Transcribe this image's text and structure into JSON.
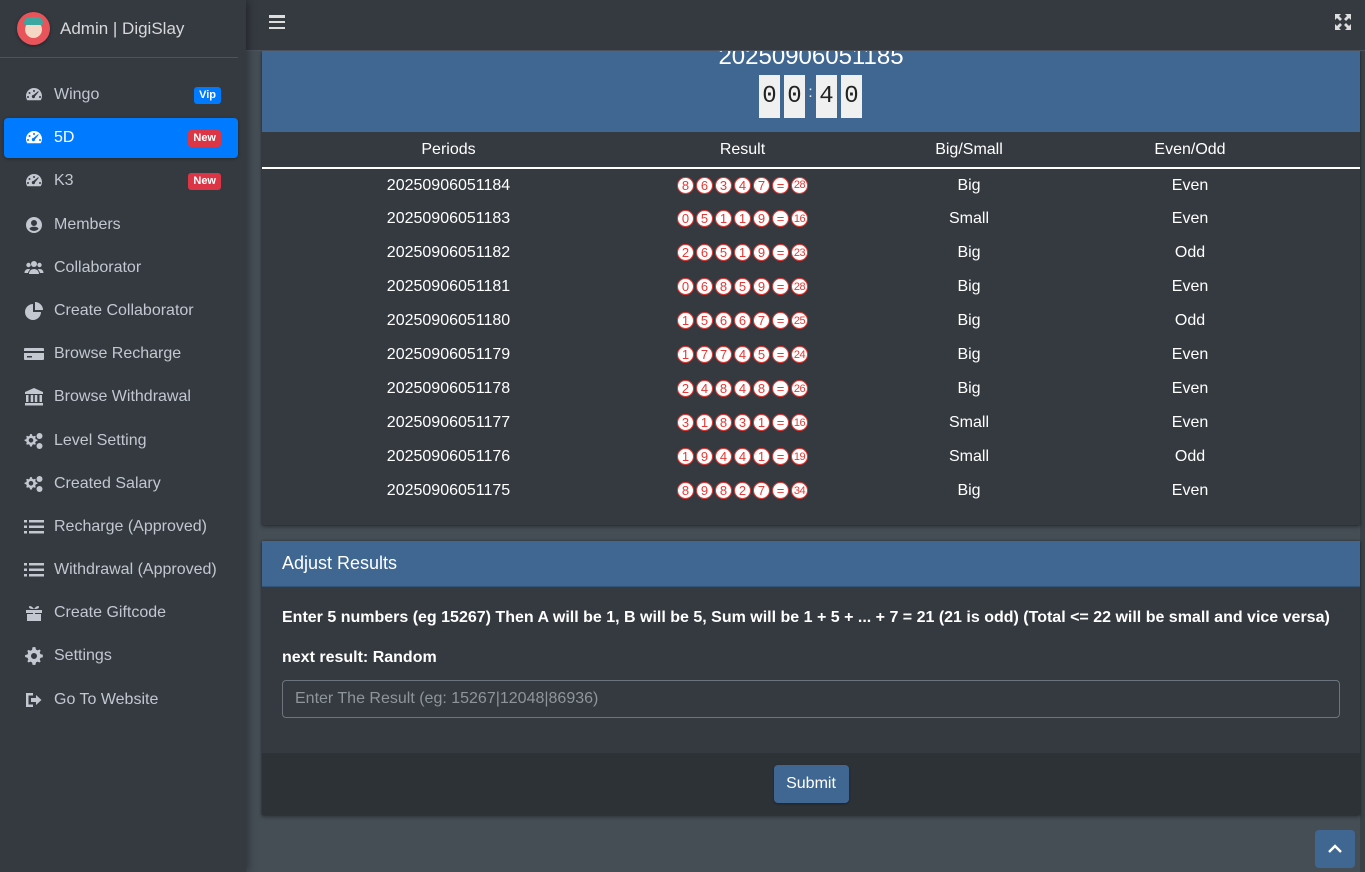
{
  "brand": {
    "title": "Admin | DigiSlay"
  },
  "sidebar": {
    "items": [
      {
        "label": "Wingo",
        "icon": "tachometer-icon",
        "badge": "Vip",
        "badge_color": "#007bff",
        "active": false
      },
      {
        "label": "5D",
        "icon": "tachometer-icon",
        "badge": "New",
        "badge_color": "#dc3545",
        "active": true
      },
      {
        "label": "K3",
        "icon": "tachometer-icon",
        "badge": "New",
        "badge_color": "#dc3545",
        "active": false
      },
      {
        "label": "Members",
        "icon": "user-circle-icon"
      },
      {
        "label": "Collaborator",
        "icon": "users-icon"
      },
      {
        "label": "Create Collaborator",
        "icon": "pie-chart-icon"
      },
      {
        "label": "Browse Recharge",
        "icon": "credit-card-icon"
      },
      {
        "label": "Browse Withdrawal",
        "icon": "bank-icon"
      },
      {
        "label": "Level Setting",
        "icon": "cogs-icon"
      },
      {
        "label": "Created Salary",
        "icon": "cogs-icon"
      },
      {
        "label": "Recharge (Approved)",
        "icon": "list-icon"
      },
      {
        "label": "Withdrawal (Approved)",
        "icon": "list-icon"
      },
      {
        "label": "Create Giftcode",
        "icon": "gift-icon"
      },
      {
        "label": "Settings",
        "icon": "gear-icon"
      },
      {
        "label": "Go To Website",
        "icon": "sign-out-icon"
      }
    ]
  },
  "game": {
    "period": "20250906051185",
    "timer": [
      "0",
      "0",
      ":",
      "4",
      "0"
    ]
  },
  "table": {
    "headers": [
      "Periods",
      "Result",
      "Big/Small",
      "Even/Odd"
    ],
    "rows": [
      {
        "period": "20250906051184",
        "digits": [
          "8",
          "6",
          "3",
          "4",
          "7"
        ],
        "sum": "28",
        "size": "Big",
        "parity": "Even"
      },
      {
        "period": "20250906051183",
        "digits": [
          "0",
          "5",
          "1",
          "1",
          "9"
        ],
        "sum": "16",
        "size": "Small",
        "parity": "Even"
      },
      {
        "period": "20250906051182",
        "digits": [
          "2",
          "6",
          "5",
          "1",
          "9"
        ],
        "sum": "23",
        "size": "Big",
        "parity": "Odd"
      },
      {
        "period": "20250906051181",
        "digits": [
          "0",
          "6",
          "8",
          "5",
          "9"
        ],
        "sum": "28",
        "size": "Big",
        "parity": "Even"
      },
      {
        "period": "20250906051180",
        "digits": [
          "1",
          "5",
          "6",
          "6",
          "7"
        ],
        "sum": "25",
        "size": "Big",
        "parity": "Odd"
      },
      {
        "period": "20250906051179",
        "digits": [
          "1",
          "7",
          "7",
          "4",
          "5"
        ],
        "sum": "24",
        "size": "Big",
        "parity": "Even"
      },
      {
        "period": "20250906051178",
        "digits": [
          "2",
          "4",
          "8",
          "4",
          "8"
        ],
        "sum": "26",
        "size": "Big",
        "parity": "Even"
      },
      {
        "period": "20250906051177",
        "digits": [
          "3",
          "1",
          "8",
          "3",
          "1"
        ],
        "sum": "16",
        "size": "Small",
        "parity": "Even"
      },
      {
        "period": "20250906051176",
        "digits": [
          "1",
          "9",
          "4",
          "4",
          "1"
        ],
        "sum": "19",
        "size": "Small",
        "parity": "Odd"
      },
      {
        "period": "20250906051175",
        "digits": [
          "8",
          "9",
          "8",
          "2",
          "7"
        ],
        "sum": "34",
        "size": "Big",
        "parity": "Even"
      }
    ],
    "equals": "="
  },
  "adjust": {
    "title": "Adjust Results",
    "instructions": "Enter 5 numbers (eg 15267) Then A will be 1, B will be 5, Sum will be 1 + 5 + ... + 7 = 21 (21 is odd) (Total <= 22 will be small and vice versa)",
    "next_result": "next result: Random",
    "input_placeholder": "Enter The Result (eg: 15267|12048|86936)",
    "input_value": "",
    "submit_label": "Submit"
  },
  "colors": {
    "primary": "#3f6791",
    "active": "#007bff",
    "danger": "#dc3545",
    "sidebar_bg": "#343a40"
  }
}
